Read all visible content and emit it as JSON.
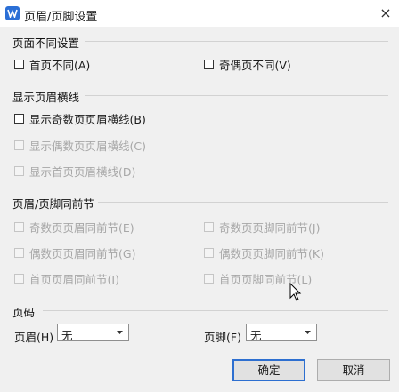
{
  "window": {
    "title": "页眉/页脚设置",
    "close_glyph": "×"
  },
  "sections": {
    "different": {
      "title": "页面不同设置",
      "first_page_different": "首页不同(A)",
      "odd_even_different": "奇偶页不同(V)"
    },
    "header_line": {
      "title": "显示页眉横线",
      "odd_header_line": "显示奇数页页眉横线(B)",
      "even_header_line": "显示偶数页页眉横线(C)",
      "first_header_line": "显示首页页眉横线(D)"
    },
    "same_as_previous": {
      "title": "页眉/页脚同前节",
      "odd_header_same": "奇数页页眉同前节(E)",
      "odd_footer_same": "奇数页页脚同前节(J)",
      "even_header_same": "偶数页页眉同前节(G)",
      "even_footer_same": "偶数页页脚同前节(K)",
      "first_header_same": "首页页眉同前节(I)",
      "first_footer_same": "首页页脚同前节(L)"
    },
    "page_number": {
      "title": "页码",
      "header_label": "页眉(H)",
      "header_value": "无",
      "footer_label": "页脚(F)",
      "footer_value": "无"
    }
  },
  "buttons": {
    "ok": "确定",
    "cancel": "取消"
  },
  "icons": {
    "app": "wps-app-icon",
    "cursor": "mouse-cursor-icon"
  },
  "colors": {
    "accent": "#2d6fd0",
    "disabled_text": "#a7a7a7"
  }
}
